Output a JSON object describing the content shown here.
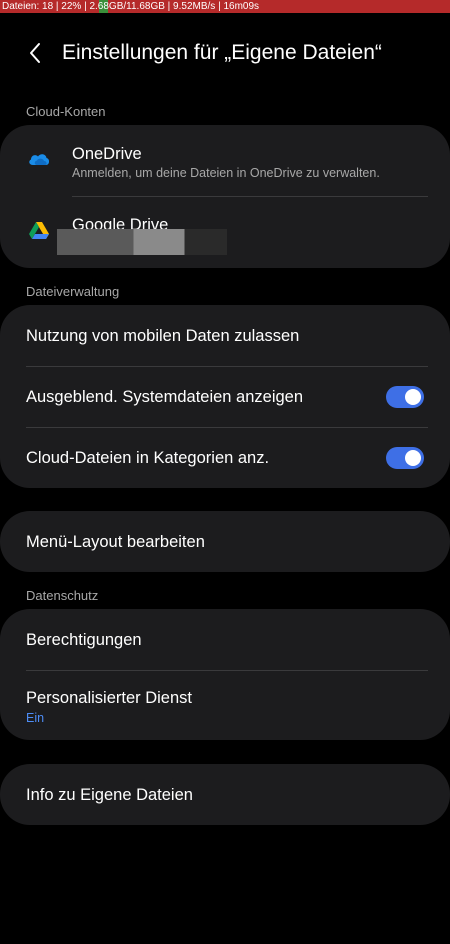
{
  "status_bar": {
    "text": "Dateien: 18 | 22% | 2.68GB/11.68GB | 9.52MB/s | 16m09s"
  },
  "header": {
    "title": "Einstellungen für „Eigene Dateien“",
    "back_icon": "chevron-left-icon"
  },
  "cloud_section": {
    "label": "Cloud-Konten",
    "onedrive": {
      "title": "OneDrive",
      "subtitle": "Anmelden, um deine Dateien in OneDrive zu verwalten.",
      "icon": "onedrive-icon"
    },
    "google_drive": {
      "title": "Google Drive",
      "icon": "google-drive-icon"
    }
  },
  "file_section": {
    "label": "Dateiverwaltung",
    "mobile_data": "Nutzung von mobilen Daten zulassen",
    "hidden_files": {
      "label": "Ausgeblend. Systemdateien anzeigen",
      "on": true
    },
    "cloud_categories": {
      "label": "Cloud-Dateien in Kategorien anz.",
      "on": true
    }
  },
  "menu_layout": "Menü-Layout bearbeiten",
  "privacy_section": {
    "label": "Datenschutz",
    "permissions": "Berechtigungen",
    "personalized": {
      "title": "Personalisierter Dienst",
      "value": "Ein"
    }
  },
  "info": "Info zu Eigene Dateien",
  "colors": {
    "background": "#000000",
    "card": "#1c1c1e",
    "accent": "#3e6fe6",
    "link": "#4d8cf5"
  }
}
